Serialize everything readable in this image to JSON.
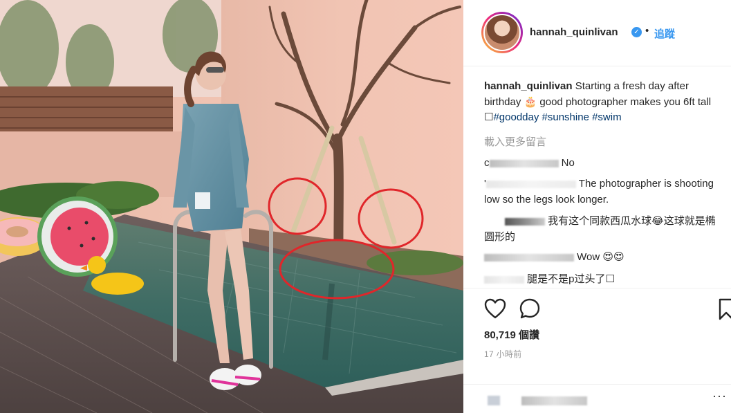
{
  "post": {
    "username": "hannah_quinlivan",
    "verified_mark": "✓",
    "separator": "•",
    "follow_label": "追蹤",
    "caption": {
      "username": "hannah_quinlivan",
      "text_1": "Starting a fresh day after birthday",
      "emoji": "🎂",
      "text_2": "good photographer makes you 6ft tall",
      "box_glyph": "☐",
      "hashtags": [
        "#goodday",
        "#sunshine",
        "#swim"
      ]
    },
    "load_more_label": "載入更多留言",
    "comments": [
      {
        "user_prefix": "c",
        "text": "No"
      },
      {
        "user_prefix": "'",
        "text": "The photographer is shooting low so the legs look longer."
      },
      {
        "user_prefix": "",
        "text": "我有这个同款西瓜水球😂这球就是椭圆形的"
      },
      {
        "user_prefix": "",
        "text": "Wow 😍😍"
      },
      {
        "user_prefix": "",
        "text": "腿是不是p过头了☐"
      }
    ],
    "likes_label": "80,719 個讚",
    "time_label": "17 小時前",
    "more_label": "···"
  },
  "icons": {
    "like": "heart-icon",
    "comment": "comment-bubble-icon",
    "save": "bookmark-icon",
    "verified": "verified-badge-icon"
  },
  "colors": {
    "link_blue": "#3897f0",
    "hashtag": "#003569",
    "muted": "#999999",
    "annotation_red": "#e0262a"
  }
}
